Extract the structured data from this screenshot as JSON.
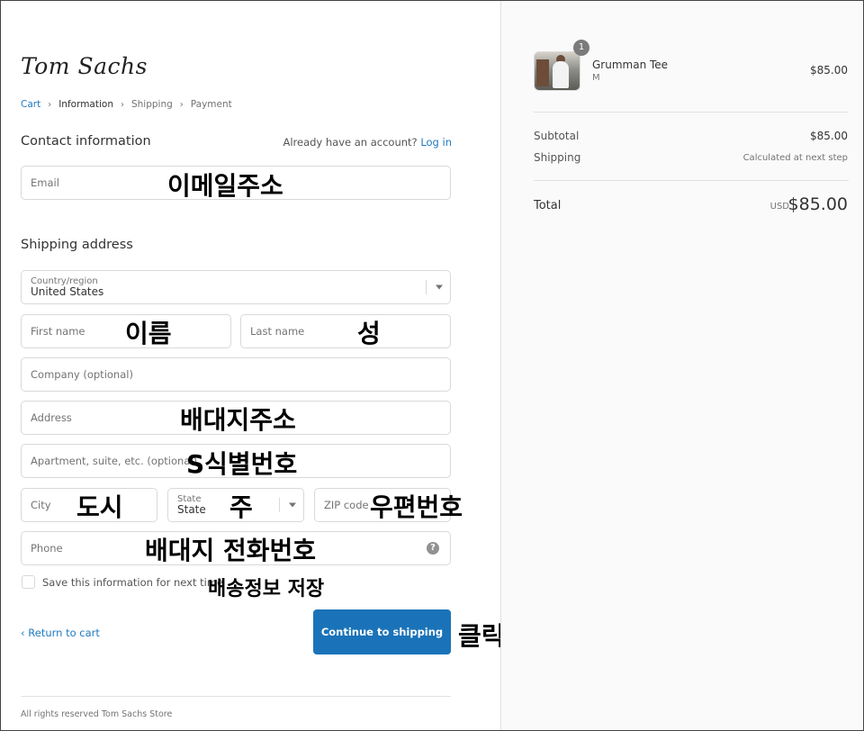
{
  "brand": {
    "logo": "Tom Sachs"
  },
  "breadcrumb": {
    "cart": "Cart",
    "information": "Information",
    "shipping": "Shipping",
    "payment": "Payment"
  },
  "contact": {
    "title": "Contact information",
    "have_account": "Already have an account?",
    "login": "Log in",
    "email_placeholder": "Email"
  },
  "shipping": {
    "title": "Shipping address",
    "country_label": "Country/region",
    "country_value": "United States",
    "first_name": "First name",
    "last_name": "Last name",
    "company": "Company (optional)",
    "address": "Address",
    "apartment": "Apartment, suite, etc. (optional)",
    "city": "City",
    "state_label": "State",
    "state_value": "State",
    "zip": "ZIP code",
    "phone": "Phone",
    "help_icon": "?",
    "save_info": "Save this information for next time"
  },
  "actions": {
    "return": "Return to cart",
    "continue": "Continue to shipping"
  },
  "footer": "All rights reserved Tom Sachs Store",
  "annotations": {
    "email": "이메일주소",
    "first_name": "이름",
    "last_name": "성",
    "address": "배대지주소",
    "apartment": "S식별번호",
    "city": "도시",
    "state": "주",
    "zip": "우편번호",
    "phone": "배대지 전화번호",
    "save": "배송정보 저장",
    "click": "클릭"
  },
  "order": {
    "item": {
      "name": "Grumman Tee",
      "size": "M",
      "price": "$85.00",
      "quantity": "1"
    },
    "subtotal_label": "Subtotal",
    "subtotal_value": "$85.00",
    "shipping_label": "Shipping",
    "shipping_value": "Calculated at next step",
    "total_label": "Total",
    "currency": "USD",
    "total_value": "$85.00"
  },
  "colors": {
    "accent": "#1a73b8",
    "link": "#1f7ac0"
  }
}
